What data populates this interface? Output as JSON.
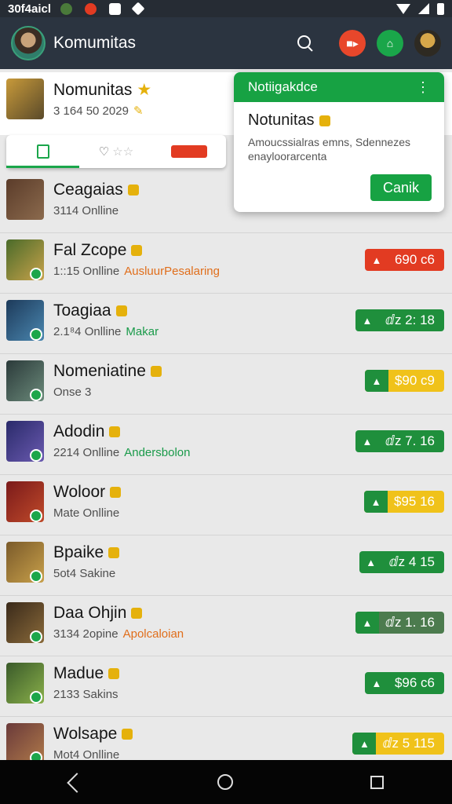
{
  "status_bar": {
    "time": "30f4aicl"
  },
  "app_bar": {
    "title": "Komumitas",
    "action1_label": "",
    "action2_label": ""
  },
  "header_item": {
    "name": "Nomunitas",
    "meta": "3 164 50 2029"
  },
  "tabs": [
    {
      "name": "tab-list",
      "label": ""
    },
    {
      "name": "tab-favorites",
      "label": "☆☆"
    },
    {
      "name": "tab-alerts",
      "label": ""
    }
  ],
  "popup": {
    "header": "Notiigakdce",
    "title": "Notunitas",
    "body": "Amoucssialras emns, Sdennezes enayloorarcenta",
    "button": "Canik"
  },
  "rows": [
    {
      "name": "Ceagaias",
      "meta": "3114 Onlline",
      "tag": "",
      "pill": "",
      "pill_style": "none",
      "colors": [
        "#5b3c2a",
        "#8b6a4d"
      ]
    },
    {
      "name": "Fal Zcope",
      "meta": "1::15 Onlline",
      "tag": "AusluurPesalaring",
      "tag_color": "#e06e1b",
      "pill": "690 c6",
      "pill_style": "red",
      "colors": [
        "#4a6b2a",
        "#c8a24a"
      ]
    },
    {
      "name": "Toagiaa",
      "meta": "2.1⁸4 Onlline",
      "tag": "Makar",
      "tag_color": "#1a9a4a",
      "pill": "ⅆz 2: 18",
      "pill_style": "green",
      "colors": [
        "#1d3a5a",
        "#4a87b0"
      ]
    },
    {
      "name": "Nomeniatine",
      "meta": "Onse 3",
      "tag": "",
      "pill": "$90 c9",
      "pill_style": "yellow",
      "colors": [
        "#2b3a3a",
        "#6b8a7a"
      ]
    },
    {
      "name": "Adodin",
      "meta": "2214 Onlline",
      "tag": "Andersbolon",
      "tag_color": "#1a9a4a",
      "pill": "ⅆz 7. 16",
      "pill_style": "green",
      "colors": [
        "#2a2a6a",
        "#6a5ab0"
      ]
    },
    {
      "name": "Woloor",
      "meta": "Mate Onlline",
      "tag": "",
      "pill": "$95 16",
      "pill_style": "yellow",
      "colors": [
        "#7a1a1a",
        "#c04a2a"
      ]
    },
    {
      "name": "Bpaike",
      "meta": "5ot4 Sakine",
      "tag": "",
      "pill": "ⅆz 4 15",
      "pill_style": "green",
      "colors": [
        "#7a5a2a",
        "#c8a04a"
      ]
    },
    {
      "name": "Daa Ohjin",
      "meta": "3134 2opine",
      "tag": "Apolcaloian",
      "tag_color": "#e06e1b",
      "pill": "ⅆz 1. 16",
      "pill_style": "dark",
      "colors": [
        "#3a2a1a",
        "#8a6a3a"
      ]
    },
    {
      "name": "Madue",
      "meta": "2133 Sakins",
      "tag": "",
      "pill": "$96 c6",
      "pill_style": "green",
      "colors": [
        "#3a5a2a",
        "#8ab04a"
      ]
    },
    {
      "name": "Wolsape",
      "meta": "Mot4 Onlline",
      "tag": "",
      "pill": "ⅆz 5 115",
      "pill_style": "yellow",
      "colors": [
        "#6a3a3a",
        "#b07a4a"
      ]
    }
  ]
}
